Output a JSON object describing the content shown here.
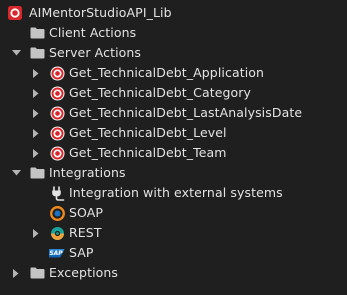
{
  "tree": {
    "root": {
      "label": "AIMentorStudioAPI_Lib",
      "icon": "outsystems-module-icon"
    },
    "client_actions": {
      "label": "Client Actions",
      "icon": "folder-icon"
    },
    "server_actions": {
      "label": "Server Actions",
      "icon": "folder-icon",
      "expanded": true,
      "items": [
        {
          "label": "Get_TechnicalDebt_Application",
          "icon": "action-icon",
          "expandable": true
        },
        {
          "label": "Get_TechnicalDebt_Category",
          "icon": "action-icon",
          "expandable": true
        },
        {
          "label": "Get_TechnicalDebt_LastAnalysisDate",
          "icon": "action-icon",
          "expandable": true
        },
        {
          "label": "Get_TechnicalDebt_Level",
          "icon": "action-icon",
          "expandable": true
        },
        {
          "label": "Get_TechnicalDebt_Team",
          "icon": "action-icon",
          "expandable": true
        }
      ]
    },
    "integrations": {
      "label": "Integrations",
      "icon": "folder-icon",
      "expanded": true,
      "items": [
        {
          "label": "Integration with external systems",
          "icon": "integration-plug-icon"
        },
        {
          "label": "SOAP",
          "icon": "soap-icon"
        },
        {
          "label": "REST",
          "icon": "rest-icon",
          "expandable": true
        },
        {
          "label": "SAP",
          "icon": "sap-icon",
          "badge_text": "SAP"
        }
      ]
    },
    "exceptions": {
      "label": "Exceptions",
      "icon": "folder-icon",
      "expanded": false
    }
  },
  "colors": {
    "background": "#1f1f1f",
    "text": "#e3e3e3",
    "arrow": "#b4b4b4",
    "folder": "#c4c4c4",
    "action_red": "#d8282b",
    "soap_orange": "#f08a1c",
    "rest_teal": "#1aa39a",
    "rest_orange": "#f0a23c",
    "sap_blue": "#1a73c6"
  }
}
